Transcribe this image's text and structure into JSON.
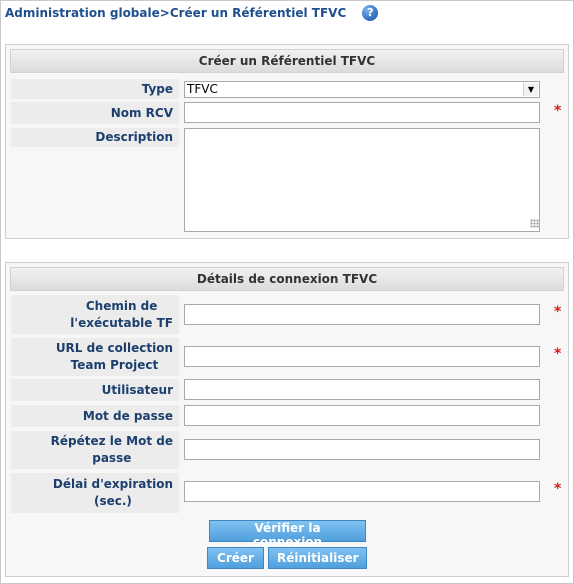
{
  "breadcrumb": {
    "parent": "Administration globale",
    "separator": ">",
    "current": "Créer un Référentiel TFVC"
  },
  "section1": {
    "title": "Créer un Référentiel TFVC",
    "type": {
      "label": "Type",
      "value": "TFVC"
    },
    "rcv_name": {
      "label": "Nom RCV",
      "value": ""
    },
    "description": {
      "label": "Description",
      "value": ""
    }
  },
  "section2": {
    "title": "Détails de connexion TFVC",
    "tf_path": {
      "label_line1": "Chemin de",
      "label_line2": "l'exécutable TF",
      "value": ""
    },
    "collection_url": {
      "label_line1": "URL de collection",
      "label_line2": "Team Project",
      "value": ""
    },
    "user": {
      "label": "Utilisateur",
      "value": ""
    },
    "password": {
      "label": "Mot de passe",
      "value": ""
    },
    "password_repeat": {
      "label_line1": "Répétez le Mot de",
      "label_line2": "passe",
      "value": ""
    },
    "timeout": {
      "label_line1": "Délai d'expiration",
      "label_line2": "(sec.)",
      "value": ""
    }
  },
  "buttons": {
    "verify": "Vérifier la connexion",
    "create": "Créer",
    "reset": "Réinitialiser"
  },
  "required_mark": "*",
  "colors": {
    "label_text": "#1c3f6e",
    "required": "#d71a1a",
    "button": "#5aa8e3"
  }
}
